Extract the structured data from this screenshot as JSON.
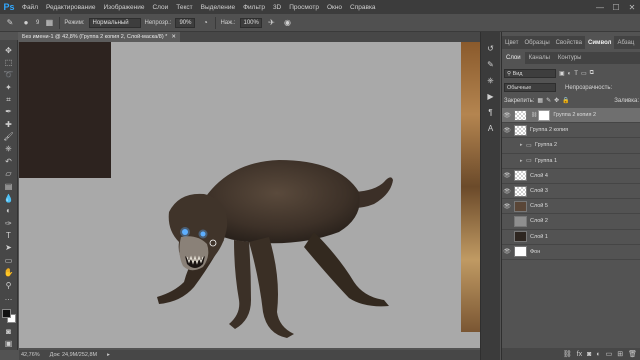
{
  "app": {
    "logo": "Ps"
  },
  "menu": [
    "Файл",
    "Редактирование",
    "Изображение",
    "Слои",
    "Текст",
    "Выделение",
    "Фильтр",
    "3D",
    "Просмотр",
    "Окно",
    "Справка"
  ],
  "window_controls": [
    "—",
    "☐",
    "✕"
  ],
  "options": {
    "brush_size": "9",
    "mode_label": "Режим:",
    "mode_value": "Нормальный",
    "opacity_label": "Непрозр.:",
    "opacity_value": "90%",
    "pressure_label": "Наж.:",
    "pressure_value": "100%"
  },
  "document": {
    "tab_title": "Без имени-1 @ 42,8% (Группа 2 копия 2, Слой-маска/8) *",
    "zoom": "42,76%",
    "doc_info": "Док: 24,9M/252,8M"
  },
  "panel": {
    "tabs": [
      "Цвет",
      "Образцы",
      "Свойства",
      "Символ",
      "Абзац"
    ],
    "active_tab": "Символ",
    "sub_tabs": [
      "Слои",
      "Каналы",
      "Контуры"
    ],
    "filter_label": "Вид",
    "blend_mode": "Обычные",
    "opacity_label": "Непрозрачность:",
    "lock_label": "Закрепить:",
    "fill_label": "Заливка:"
  },
  "layers": [
    {
      "name": "Группа 2 копия 2",
      "visible": true,
      "thumb": "checker",
      "mask": true,
      "selected": true,
      "indent": 0
    },
    {
      "name": "Группа 2 копия",
      "visible": true,
      "thumb": "checker",
      "mask": false,
      "selected": false,
      "indent": 0
    },
    {
      "name": "Группа 2",
      "visible": false,
      "folder": true,
      "selected": false,
      "indent": 1
    },
    {
      "name": "Группа 1",
      "visible": false,
      "folder": true,
      "selected": false,
      "indent": 1
    },
    {
      "name": "Слой 4",
      "visible": true,
      "thumb": "checker",
      "mask": false,
      "selected": false,
      "indent": 0
    },
    {
      "name": "Слой 3",
      "visible": true,
      "thumb": "checker",
      "mask": false,
      "selected": false,
      "indent": 0
    },
    {
      "name": "Слой 5",
      "visible": true,
      "thumb": "brown",
      "mask": false,
      "selected": false,
      "indent": 0
    },
    {
      "name": "Слой 2",
      "visible": false,
      "thumb": "gray",
      "mask": false,
      "selected": false,
      "indent": 0
    },
    {
      "name": "Слой 1",
      "visible": false,
      "thumb": "dark",
      "mask": false,
      "selected": false,
      "indent": 0
    },
    {
      "name": "Фон",
      "visible": true,
      "thumb": "white",
      "mask": false,
      "selected": false,
      "indent": 0
    }
  ],
  "panel_bottom_icons": [
    "link-icon",
    "fx-icon",
    "mask-icon",
    "adjustment-icon",
    "folder-icon",
    "new-layer-icon",
    "trash-icon"
  ],
  "colors": {
    "accent": "#31a8ff",
    "canvas_bg": "#a9a9a9",
    "ui_bg": "#535353"
  }
}
